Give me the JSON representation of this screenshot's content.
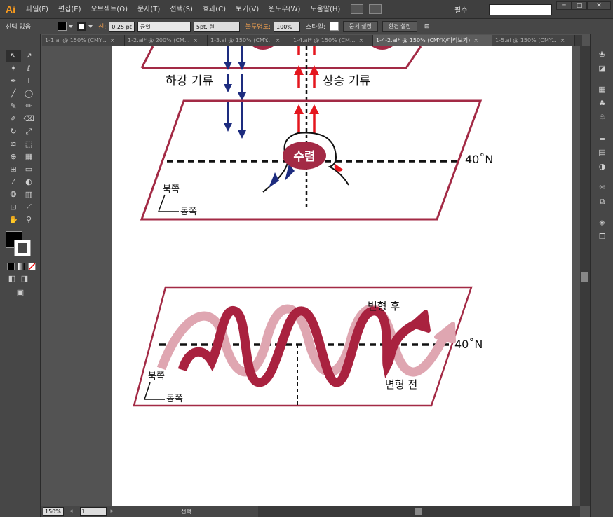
{
  "app": {
    "logo": "Ai"
  },
  "menu": [
    "파일(F)",
    "편집(E)",
    "오브젝트(O)",
    "문자(T)",
    "선택(S)",
    "효과(C)",
    "보기(V)",
    "윈도우(W)",
    "도움말(H)"
  ],
  "workspace": {
    "label": "필수"
  },
  "window_controls": {
    "minimize": "─",
    "maximize": "□",
    "close": "✕"
  },
  "control_bar": {
    "selection": "선택 없음",
    "stroke_label": "선:",
    "stroke_weight": "0.25 pt",
    "stroke_profile": "균일",
    "brush": "5pt. 원",
    "opacity_label": "불투명도:",
    "opacity_value": "100%",
    "style_label": "스타일:",
    "document_setup": "문서 설정",
    "preferences": "환경 설정"
  },
  "tabs": [
    {
      "label": "1-1.ai @ 150% (CMY...",
      "close": "×",
      "active": false
    },
    {
      "label": "1-2.ai* @ 200% (CM...",
      "close": "×",
      "active": false
    },
    {
      "label": "1-3.ai @ 150% (CMY...",
      "close": "×",
      "active": false
    },
    {
      "label": "1-4.ai* @ 150% (CM...",
      "close": "×",
      "active": false
    },
    {
      "label": "1-4-2.ai* @ 150% (CMYK/미리보기)",
      "close": "×",
      "active": true
    },
    {
      "label": "1-5.ai @ 150% (CMY...",
      "close": "×",
      "active": false
    }
  ],
  "tools": [
    {
      "name": "selection-tool",
      "glyph": "↖"
    },
    {
      "name": "direct-selection-tool",
      "glyph": "↗"
    },
    {
      "name": "magic-wand-tool",
      "glyph": "✶"
    },
    {
      "name": "lasso-tool",
      "glyph": "ℓ"
    },
    {
      "name": "pen-tool",
      "glyph": "✒"
    },
    {
      "name": "type-tool",
      "glyph": "T"
    },
    {
      "name": "line-tool",
      "glyph": "╱"
    },
    {
      "name": "ellipse-tool",
      "glyph": "◯"
    },
    {
      "name": "paintbrush-tool",
      "glyph": "✎"
    },
    {
      "name": "pencil-tool",
      "glyph": "✏"
    },
    {
      "name": "blob-brush-tool",
      "glyph": "✐"
    },
    {
      "name": "eraser-tool",
      "glyph": "⌫"
    },
    {
      "name": "rotate-tool",
      "glyph": "↻"
    },
    {
      "name": "scale-tool",
      "glyph": "⤢"
    },
    {
      "name": "warp-tool",
      "glyph": "≋"
    },
    {
      "name": "free-transform-tool",
      "glyph": "⬚"
    },
    {
      "name": "shape-builder-tool",
      "glyph": "⊕"
    },
    {
      "name": "perspective-grid-tool",
      "glyph": "▦"
    },
    {
      "name": "mesh-tool",
      "glyph": "⊞"
    },
    {
      "name": "gradient-tool",
      "glyph": "▭"
    },
    {
      "name": "eyedropper-tool",
      "glyph": "⁄"
    },
    {
      "name": "blend-tool",
      "glyph": "◐"
    },
    {
      "name": "symbol-sprayer-tool",
      "glyph": "❂"
    },
    {
      "name": "column-graph-tool",
      "glyph": "▥"
    },
    {
      "name": "artboard-tool",
      "glyph": "⊡"
    },
    {
      "name": "slice-tool",
      "glyph": "⟋"
    },
    {
      "name": "hand-tool",
      "glyph": "✋"
    },
    {
      "name": "zoom-tool",
      "glyph": "⚲"
    }
  ],
  "artwork": {
    "updraft": "상승 기류",
    "downdraft": "하강 기류",
    "convergence": "수렴",
    "lat_top": "40˚N",
    "north_top": "북쪽",
    "east_top": "동쪽",
    "lat_bottom": "40˚N",
    "after": "변형 후",
    "before": "변형 전",
    "north_bottom": "북쪽",
    "east_bottom": "동쪽",
    "colors": {
      "frame": "#a32a45",
      "blue": "#1d2c7f",
      "red": "#e4161e",
      "dark_wave": "#a9223f",
      "light_wave": "#dfa6b1"
    }
  },
  "status": {
    "zoom": "150%",
    "page": "1",
    "label": "선택"
  }
}
